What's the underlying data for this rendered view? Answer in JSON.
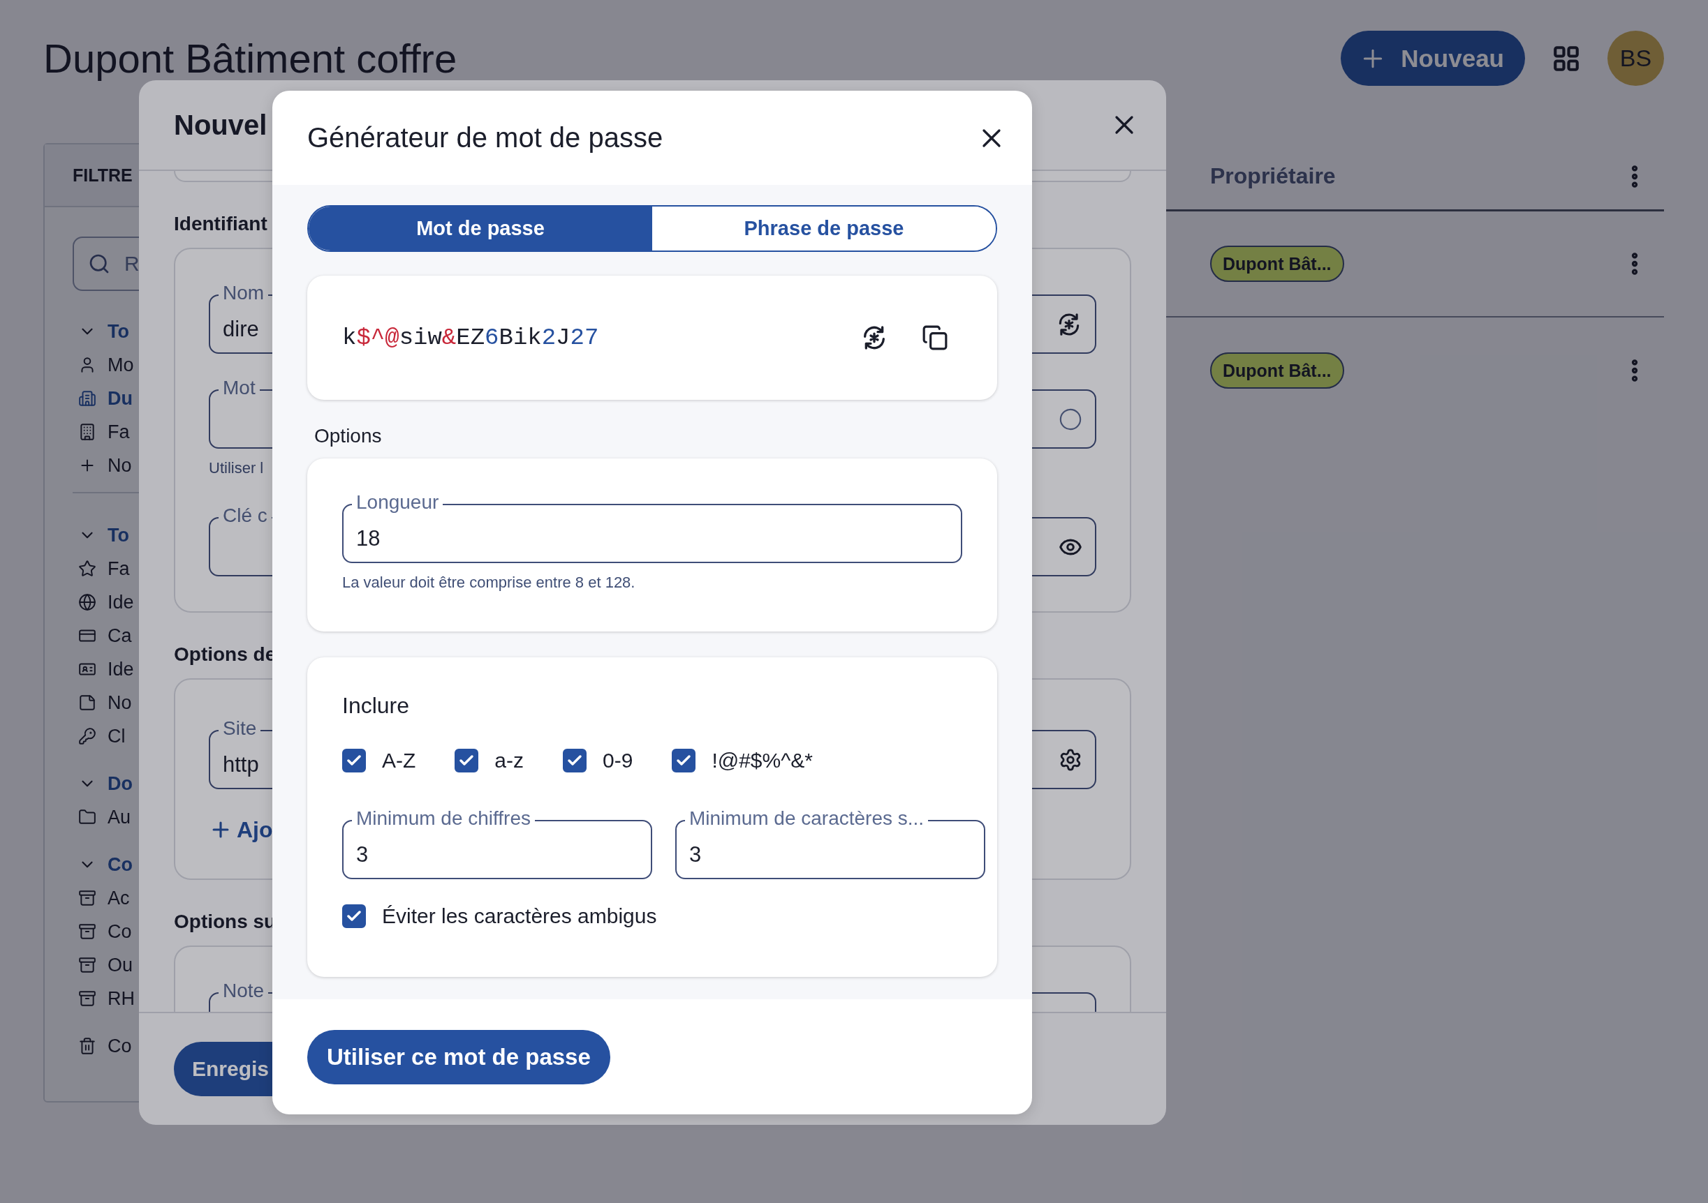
{
  "page": {
    "title": "Dupont Bâtiment coffre",
    "new_button": "Nouveau",
    "avatar": "BS"
  },
  "filters": {
    "heading": "FILTRE",
    "search": {
      "placeholder": "R"
    },
    "groups": [
      {
        "label": "To",
        "expanded": true,
        "items": [
          {
            "label": "Mo",
            "selected": false
          },
          {
            "label": "Du",
            "selected": true
          },
          {
            "label": "Fa",
            "selected": false
          },
          {
            "label": "No",
            "selected": false
          }
        ]
      },
      {
        "label": "To",
        "expanded": true,
        "items": [
          {
            "label": "Fa",
            "selected": false
          },
          {
            "label": "Ide",
            "selected": false
          },
          {
            "label": "Ca",
            "selected": false
          },
          {
            "label": "Ide",
            "selected": false
          },
          {
            "label": "No",
            "selected": false
          },
          {
            "label": "Cl",
            "selected": false
          }
        ]
      },
      {
        "label": "Do",
        "expanded": true,
        "items": [
          {
            "label": "Au",
            "selected": false
          }
        ]
      },
      {
        "label": "Co",
        "expanded": true,
        "items": [
          {
            "label": "Ac",
            "selected": false
          },
          {
            "label": "Co",
            "selected": false
          },
          {
            "label": "Ou",
            "selected": false
          },
          {
            "label": "RH",
            "selected": false
          }
        ]
      }
    ],
    "trash": {
      "label": "Co"
    }
  },
  "table": {
    "columns": [
      {
        "label": "Propriétaire"
      }
    ],
    "rows": [
      {
        "owner": "Dupont Bât..."
      },
      {
        "owner": "Dupont Bât..."
      }
    ]
  },
  "item_dialog": {
    "title": "Nouvel",
    "sections": [
      {
        "heading": "Identifiant",
        "fields": [
          {
            "kind": "username",
            "label": "Nom",
            "value": "dire"
          },
          {
            "kind": "password",
            "label": "Mot",
            "helper": "Utiliser l"
          },
          {
            "kind": "secret",
            "label": "Clé c"
          }
        ]
      },
      {
        "heading": "Options de",
        "fields": [
          {
            "kind": "url",
            "label": "Site",
            "value": "http"
          }
        ],
        "add_link": "Ajo"
      },
      {
        "heading": "Options su",
        "fields": [
          {
            "kind": "note",
            "label": "Note"
          }
        ]
      }
    ],
    "save_button": "Enregis"
  },
  "generator": {
    "title": "Générateur de mot de passe",
    "tabs": [
      {
        "label": "Mot de passe",
        "selected": true
      },
      {
        "label": "Phrase de passe",
        "selected": false
      }
    ],
    "password": "k$^@siw&EZ6Bik2J27",
    "options_heading": "Options",
    "length": {
      "label": "Longueur",
      "value": "18",
      "helper": "La valeur doit être comprise entre 8 et 128."
    },
    "include": {
      "heading": "Inclure",
      "options": [
        {
          "label": "A-Z",
          "checked": true
        },
        {
          "label": "a-z",
          "checked": true
        },
        {
          "label": "0-9",
          "checked": true
        },
        {
          "label": "!@#$%^&*",
          "checked": true
        }
      ],
      "fields": [
        {
          "label": "Minimum de chiffres",
          "value": "3"
        },
        {
          "label": "Minimum de caractères s...",
          "value": "3"
        }
      ],
      "avoid_ambiguous": {
        "label": "Éviter les caractères ambigus",
        "checked": true
      }
    },
    "use_button": "Utiliser ce mot de passe"
  }
}
